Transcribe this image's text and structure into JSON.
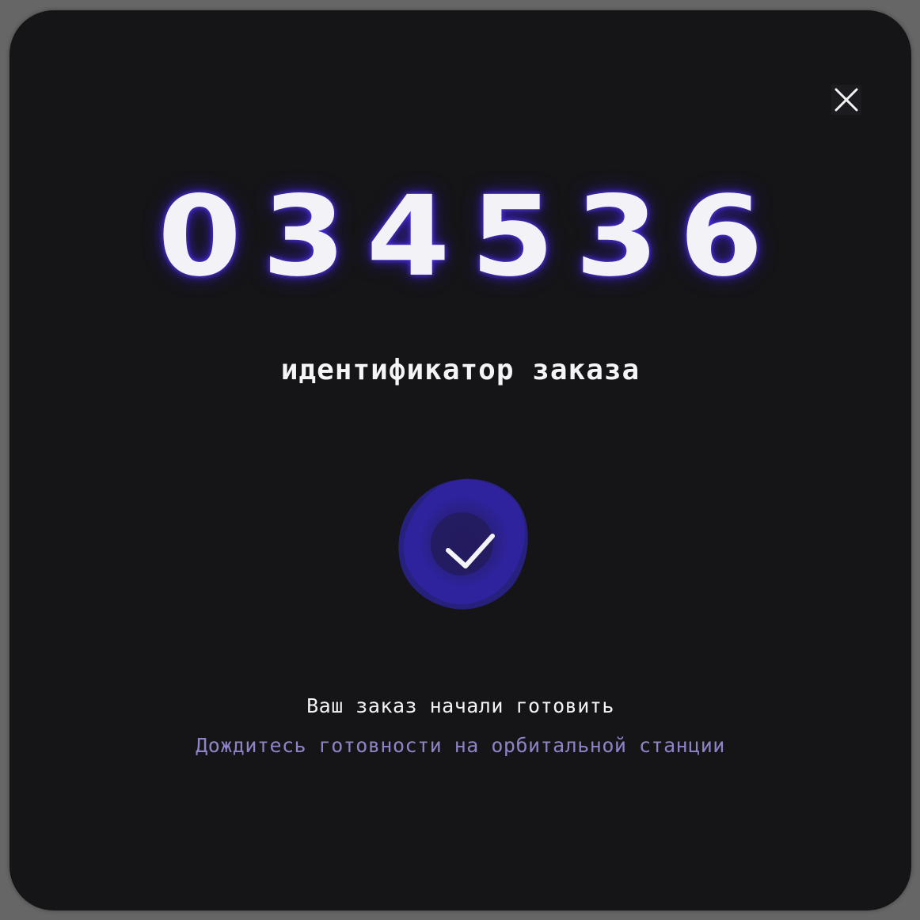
{
  "order": {
    "number": "034536",
    "label": "идентификатор заказа"
  },
  "status": {
    "title": "Ваш заказ начали готовить",
    "subtitle": "Дождитесь готовности на орбитальной станции",
    "icon": "check-icon"
  },
  "controls": {
    "close_icon": "close-icon"
  },
  "colors": {
    "modal_background": "#151518",
    "overlay": "#666666",
    "glow": "#4a2ee6",
    "badge": "#2a1f7a",
    "subtitle": "#8d83c6",
    "text": "#f3f3f5"
  }
}
